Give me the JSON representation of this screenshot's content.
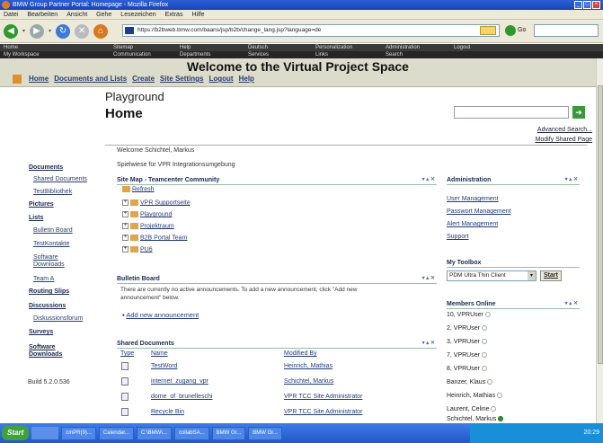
{
  "window": {
    "title": "BMW Group Partner Portal: Homepage - Mozilla Firefox"
  },
  "menu": [
    "Datei",
    "Bearbeiten",
    "Ansicht",
    "Gehe",
    "Lesezeichen",
    "Extras",
    "Hilfe"
  ],
  "address": {
    "url": "https://b2bweb.bmw.com/baans/jsp/b2b/change_lang.jsp?language=de",
    "go_label": "Go"
  },
  "portal_nav": {
    "row1": [
      "Home",
      "Sitemap",
      "Help",
      "Deutsch",
      "Personalization",
      "Administration",
      "Logout"
    ],
    "row2": [
      "My Workspace",
      "Communication",
      "Departments",
      "Services",
      "Links",
      "Search"
    ]
  },
  "site": {
    "title": "Welcome to the Virtual Project Space",
    "nav": [
      "Home",
      "Documents and Lists",
      "Create",
      "Site Settings",
      "Logout",
      "Help"
    ]
  },
  "page": {
    "title": "Playground",
    "subtitle": "Home",
    "welcome": "Welcome Schichtel, Markus",
    "description": "Spielwiese für VPR Integrationsumgebung",
    "advanced_search": "Advanced Search...",
    "modify_page": "Modify Shared Page"
  },
  "leftnav": {
    "documents": "Documents",
    "shared_documents": "Shared Documents",
    "testbibliothek": "TestBibliothek",
    "pictures": "Pictures",
    "lists": "Lists",
    "bulletin_board": "Bulletin Board",
    "testkontakte": "TestKontakte",
    "software_downloads_1": "Software",
    "software_downloads_2": "Downloads",
    "team_a": "Team A",
    "routing_slips": "Routing Slips",
    "discussions": "Discussions",
    "diskussionsforum": "Diskussionsforum",
    "surveys": "Surveys",
    "software_downloads_h1": "Software",
    "software_downloads_h2": "Downloads",
    "build": "Build 5.2.0.536"
  },
  "sitemap": {
    "title": "Site Map - Teamcenter Community",
    "refresh": "Refresh",
    "items": [
      "VPR Supportseite",
      "Playground",
      "Projektraum",
      "B2B Portal Team",
      "PU6"
    ]
  },
  "bulletin": {
    "title": "Bulletin Board",
    "text1": "There are currently no active announcements. To add a new announcement, click \"Add new",
    "text2": "announcement\" below.",
    "add": "Add new announcement"
  },
  "shared_docs": {
    "title": "Shared Documents",
    "headers": {
      "type": "Type",
      "name": "Name",
      "modified": "Modified By"
    },
    "rows": [
      {
        "name": "TestWord",
        "modified": "Heinrich, Mathias"
      },
      {
        "name": "internet_zugang_vpr",
        "modified": "Schichtel, Markus"
      },
      {
        "name": "dome_of_brunelleschi",
        "modified": "VPR TCC Site Administrator"
      },
      {
        "name": "Recycle Bin",
        "modified": "VPR TCC Site Administrator"
      }
    ]
  },
  "administration": {
    "title": "Administration",
    "links": [
      "User Management",
      "Passwort Management",
      "Alert Management",
      "Support"
    ]
  },
  "toolbox": {
    "title": "My Toolbox",
    "selected": "PDM Ultra Thin Client",
    "start": "Start"
  },
  "members": {
    "title": "Members Online",
    "list": [
      "10, VPRUser",
      "2, VPRUser",
      "3, VPRUser",
      "7, VPRUser",
      "8, VPRUser",
      "Banzer, Klaus",
      "Heinrich, Mathias",
      "Laurent, Celine",
      "Schichtel, Markus"
    ]
  },
  "taskbar": {
    "start": "Start",
    "buttons": [
      "cmPR(9)...",
      "Calendar...",
      "C:\\BMW\\...",
      "collabSA...",
      "BMW Gr...",
      "BMW Gr..."
    ],
    "clock": "20:29"
  }
}
